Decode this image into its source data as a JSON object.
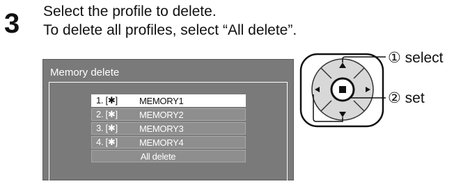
{
  "step": {
    "number": "3"
  },
  "instructions": {
    "line1": "Select the profile to delete.",
    "line2": "To delete all profiles, select “All delete”."
  },
  "dialog": {
    "title": "Memory delete",
    "items": [
      {
        "index": "1. [✱]",
        "name": "MEMORY1",
        "selected": true
      },
      {
        "index": "2. [✱]",
        "name": "MEMORY2",
        "selected": false
      },
      {
        "index": "3. [✱]",
        "name": "MEMORY3",
        "selected": false
      },
      {
        "index": "4. [✱]",
        "name": "MEMORY4",
        "selected": false
      }
    ],
    "all_delete_label": "All delete"
  },
  "remote": {
    "select_label": "① select",
    "set_label": "② set",
    "icons": [
      "up-arrow-icon",
      "down-arrow-icon",
      "left-arrow-icon",
      "right-arrow-icon",
      "set-button-icon"
    ]
  },
  "colors": {
    "dialog_bg": "#7a7a7a",
    "row_bg": "#8e8e8e",
    "selected_row_bg": "#ffffff"
  }
}
